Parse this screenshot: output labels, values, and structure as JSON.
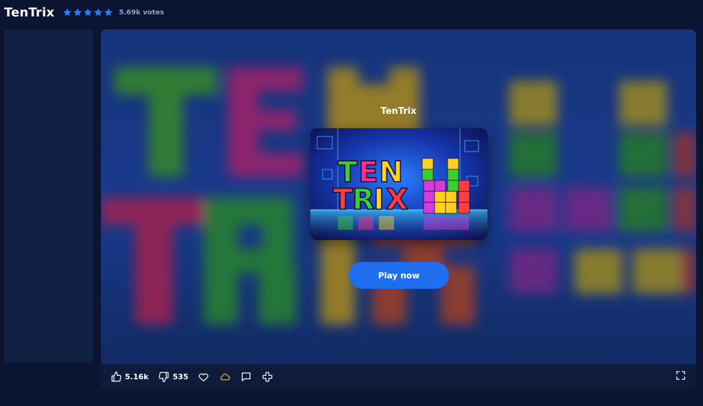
{
  "header": {
    "title": "TenTrix",
    "rating_stars": 5,
    "votes": "5.69k votes"
  },
  "player": {
    "game_name": "TenTrix",
    "thumbnail_text": [
      "TEN",
      "TRIX"
    ],
    "play_label": "Play now"
  },
  "toolbar": {
    "likes": "5.16k",
    "dislikes": "535",
    "icons": [
      "thumbs-up-icon",
      "thumbs-down-icon",
      "heart-icon",
      "cloud-icon",
      "comment-icon",
      "plus-icon",
      "fullscreen-icon"
    ]
  },
  "colors": {
    "background": "#0b1430",
    "accent": "#1f6ef0",
    "star": "#2a7bff",
    "cloud": "#f2b21b"
  }
}
